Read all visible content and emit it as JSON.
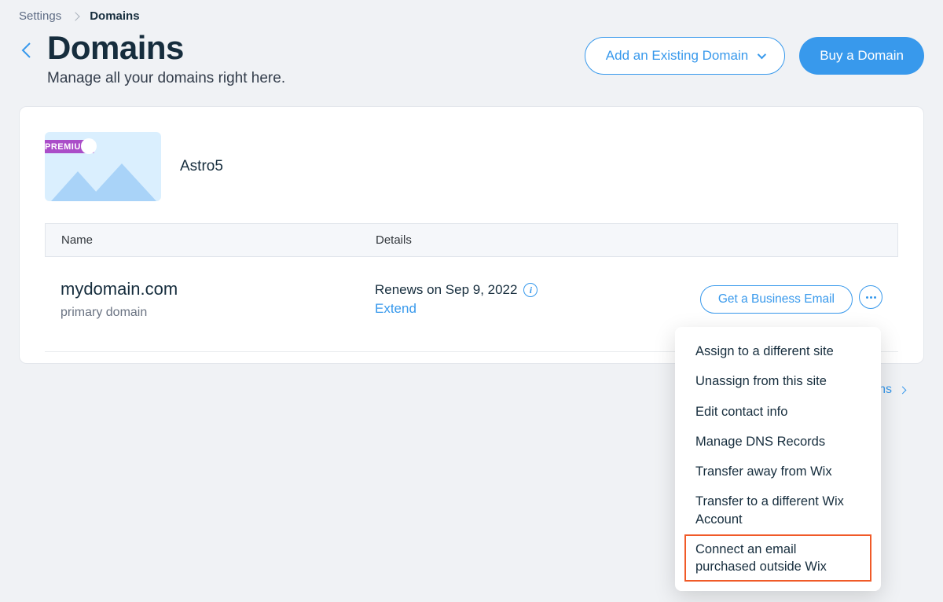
{
  "breadcrumb": {
    "parent": "Settings",
    "current": "Domains"
  },
  "header": {
    "title": "Domains",
    "subtitle": "Manage all your domains right here.",
    "add_existing_label": "Add an Existing Domain",
    "buy_label": "Buy a Domain"
  },
  "site": {
    "badge": "PREMIUM",
    "name": "Astro5"
  },
  "table": {
    "columns": {
      "name": "Name",
      "details": "Details"
    },
    "row": {
      "domain": "mydomain.com",
      "subtext": "primary domain",
      "renews": "Renews on Sep 9, 2022",
      "extend": "Extend",
      "business_email_label": "Get a Business Email"
    }
  },
  "dropdown": {
    "items": [
      "Assign to a different site",
      "Unassign from this site",
      "Edit contact info",
      "Manage DNS Records",
      "Transfer away from Wix",
      "Transfer to a different Wix Account",
      "Connect an email purchased outside Wix"
    ]
  },
  "footer": {
    "link_fragment": "ains"
  }
}
